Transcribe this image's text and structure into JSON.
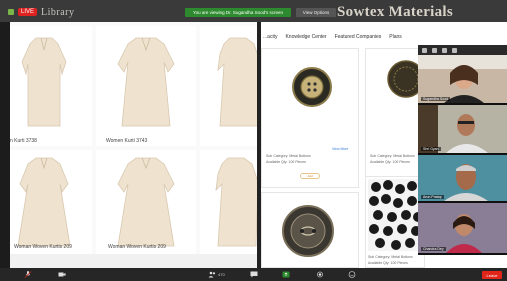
{
  "banner": {
    "live_badge": "LIVE",
    "left_title": "Library",
    "share_notice": "You are viewing Dr. Sugandha Sood's screen",
    "view_options": "View Options",
    "right_title": "Sowtex Materials Library"
  },
  "left_products": [
    {
      "label": "n Kurti 3738"
    },
    {
      "label": "Women Kurti 3743"
    },
    {
      "label": ""
    },
    {
      "label": "Woman Woven Kurtis 209"
    },
    {
      "label": "Woman Woven Kurtis 209"
    },
    {
      "label": ""
    }
  ],
  "nav": {
    "items": [
      "...acity",
      "Knowledge Center",
      "Featured Companies",
      "Plans"
    ]
  },
  "right_products": [
    {
      "sub_category": "Sub Category: Metal Buttons",
      "available_qty": "Available Qty: 100 Pieces",
      "more": "View More",
      "add": "Add"
    },
    {
      "sub_category": "Sub Category: Metal Buttons",
      "available_qty": "Available Qty: 100 Pieces",
      "more": "",
      "add": ""
    },
    {
      "sub_category": "Sub Category: Metal Buttons",
      "available_qty": "Available Qty: 100 Pieces",
      "more": "",
      "add": ""
    }
  ],
  "participants": [
    {
      "name": "Sugandha Sood",
      "bg": "#6b4c3b"
    },
    {
      "name": "Shri Gyan",
      "bg": "#9a9482"
    },
    {
      "name": "Arun Pratap",
      "bg": "#3f7a8a"
    },
    {
      "name": "Chandra Dey",
      "bg": "#7c6a8a"
    }
  ],
  "bottombar": {
    "audio": "",
    "participants_count": "470",
    "end": "Leave"
  },
  "colors": {
    "accent_green": "#2e8a2e",
    "end_red": "#e0251b",
    "kurti": "#efe3d0"
  }
}
